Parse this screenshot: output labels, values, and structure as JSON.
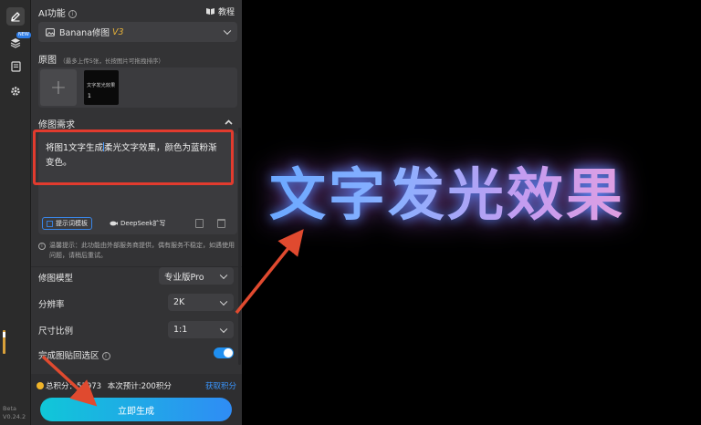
{
  "rail": {
    "new_badge": "NEW",
    "version_line1": "Beta",
    "version_line2": "V0.24.2"
  },
  "ai": {
    "title": "AI功能",
    "tutorial": "教程",
    "model_select": "Banana修图",
    "model_version": "V3"
  },
  "source": {
    "title": "原图",
    "hint": "（最多上传5张，长按图片可拖拽排序）",
    "thumb_text": "文字发光效果",
    "thumb_index": "1"
  },
  "request": {
    "title": "修图需求",
    "text_before_cursor": "将图1文字生成",
    "text_after_cursor": "柔光文字效果，颜色为蓝粉渐变色。",
    "template_btn": "提示词模板",
    "deepseek_btn": "DeepSeek扩写"
  },
  "warning": "温馨提示：此功能由外部服务商提供，偶有服务不稳定，如遇使用问题，请稍后重试。",
  "settings": {
    "model_label": "修图模型",
    "model_value": "专业版Pro",
    "resolution_label": "分辨率",
    "resolution_value": "2K",
    "ratio_label": "尺寸比例",
    "ratio_value": "1:1",
    "paste_label": "完成图贴回选区",
    "paste_enabled": true
  },
  "footer": {
    "total_points": "总积分：53973",
    "estimate": "本次预计:200积分",
    "get_points": "获取积分",
    "generate": "立即生成"
  },
  "preview": {
    "text": "文字发光效果"
  },
  "colors": {
    "accent": "#1f8ff0",
    "highlight_box": "#e23b2e",
    "arrow": "#e04a2f",
    "coin": "#f0b429"
  }
}
